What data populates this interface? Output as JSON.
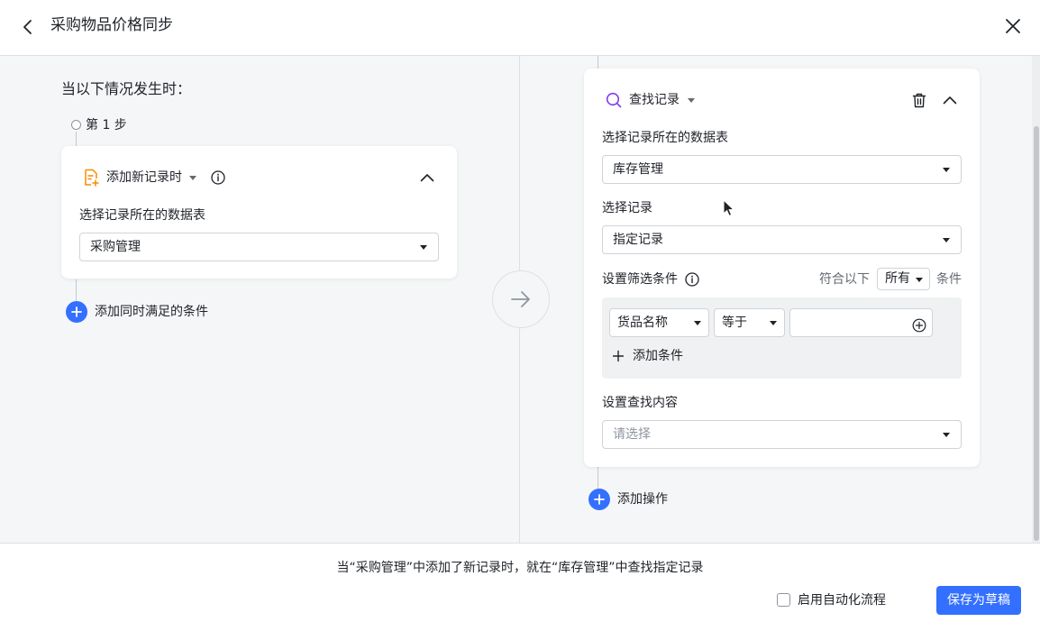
{
  "header": {
    "title": "采购物品价格同步"
  },
  "trigger": {
    "section_title": "当以下情况发生时：",
    "step_label": "第 1 步",
    "card_title": "添加新记录时",
    "table_label": "选择记录所在的数据表",
    "table_value": "采购管理",
    "add_condition_label": "添加同时满足的条件"
  },
  "action": {
    "card_title": "查找记录",
    "table_label": "选择记录所在的数据表",
    "table_value": "库存管理",
    "record_label": "选择记录",
    "record_value": "指定记录",
    "filter_label": "设置筛选条件",
    "match_prefix": "符合以下",
    "match_value": "所有",
    "match_suffix": "条件",
    "filter_field": "货品名称",
    "filter_operator": "等于",
    "filter_value": "",
    "add_filter_label": "添加条件",
    "find_content_label": "设置查找内容",
    "find_content_placeholder": "请选择",
    "add_action_label": "添加操作"
  },
  "footer": {
    "summary": "当“采购管理”中添加了新记录时，就在“库存管理”中查找指定记录",
    "enable_label": "启用自动化流程",
    "enable_checked": false,
    "save_label": "保存为草稿"
  },
  "icons": {
    "back": "chevron-left-icon",
    "close": "close-icon",
    "trigger": "add-record-icon",
    "info": "info-icon",
    "collapse": "chevron-up-icon",
    "search": "search-icon",
    "delete": "trash-icon",
    "arrow": "arrow-right-icon",
    "plus": "plus-icon",
    "plus_circle": "plus-circle-icon"
  },
  "colors": {
    "accent": "#3370ff",
    "trigger_icon": "#ff8800",
    "search_icon": "#7f3bf5"
  }
}
